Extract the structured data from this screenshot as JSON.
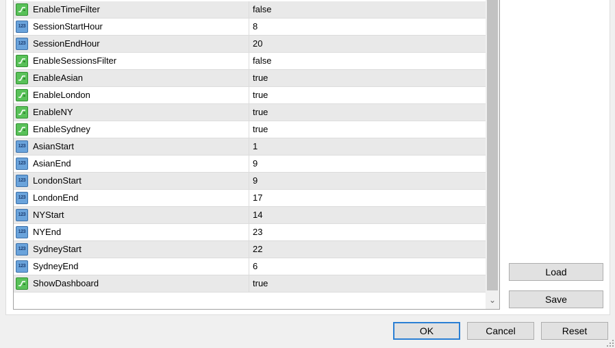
{
  "parameters": [
    {
      "name": "EnableTimeFilter",
      "value": "false",
      "type": "bool"
    },
    {
      "name": "SessionStartHour",
      "value": "8",
      "type": "int"
    },
    {
      "name": "SessionEndHour",
      "value": "20",
      "type": "int"
    },
    {
      "name": "EnableSessionsFilter",
      "value": "false",
      "type": "bool"
    },
    {
      "name": "EnableAsian",
      "value": "true",
      "type": "bool"
    },
    {
      "name": "EnableLondon",
      "value": "true",
      "type": "bool"
    },
    {
      "name": "EnableNY",
      "value": "true",
      "type": "bool"
    },
    {
      "name": "EnableSydney",
      "value": "true",
      "type": "bool"
    },
    {
      "name": "AsianStart",
      "value": "1",
      "type": "int"
    },
    {
      "name": "AsianEnd",
      "value": "9",
      "type": "int"
    },
    {
      "name": "LondonStart",
      "value": "9",
      "type": "int"
    },
    {
      "name": "LondonEnd",
      "value": "17",
      "type": "int"
    },
    {
      "name": "NYStart",
      "value": "14",
      "type": "int"
    },
    {
      "name": "NYEnd",
      "value": "23",
      "type": "int"
    },
    {
      "name": "SydneyStart",
      "value": "22",
      "type": "int"
    },
    {
      "name": "SydneyEnd",
      "value": "6",
      "type": "int"
    },
    {
      "name": "ShowDashboard",
      "value": "true",
      "type": "bool"
    }
  ],
  "icons": {
    "bool": "boolean-parameter-icon",
    "int": "numeric-parameter-icon",
    "int_glyph": "123"
  },
  "scrollbar": {
    "down_arrow": "⌄"
  },
  "buttons": {
    "load": "Load",
    "save": "Save",
    "ok": "OK",
    "cancel": "Cancel",
    "reset": "Reset"
  },
  "colors": {
    "bool_icon": "#59c159",
    "int_icon": "#6aa3db",
    "row_alt": "#e9e9e9",
    "default_button_border": "#2a7fd4"
  }
}
